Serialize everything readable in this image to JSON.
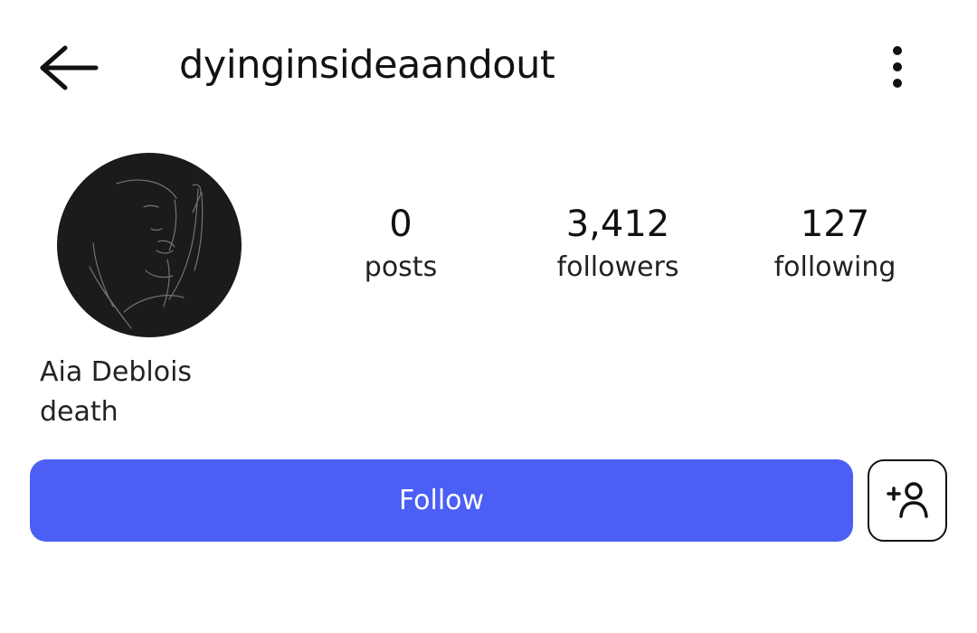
{
  "header": {
    "username": "dyinginsideaandout",
    "back_icon": "back-arrow-icon",
    "more_icon": "vertical-dots-icon"
  },
  "profile": {
    "avatar_icon": "profile-avatar-line-drawing",
    "display_name": "Aia Deblois",
    "bio": "death"
  },
  "stats": [
    {
      "value": "0",
      "label": "posts"
    },
    {
      "value": "3,412",
      "label": "followers"
    },
    {
      "value": "127",
      "label": "following"
    }
  ],
  "actions": {
    "follow_label": "Follow",
    "follow_color": "#4b5ff5",
    "suggest_icon": "add-person-icon"
  }
}
